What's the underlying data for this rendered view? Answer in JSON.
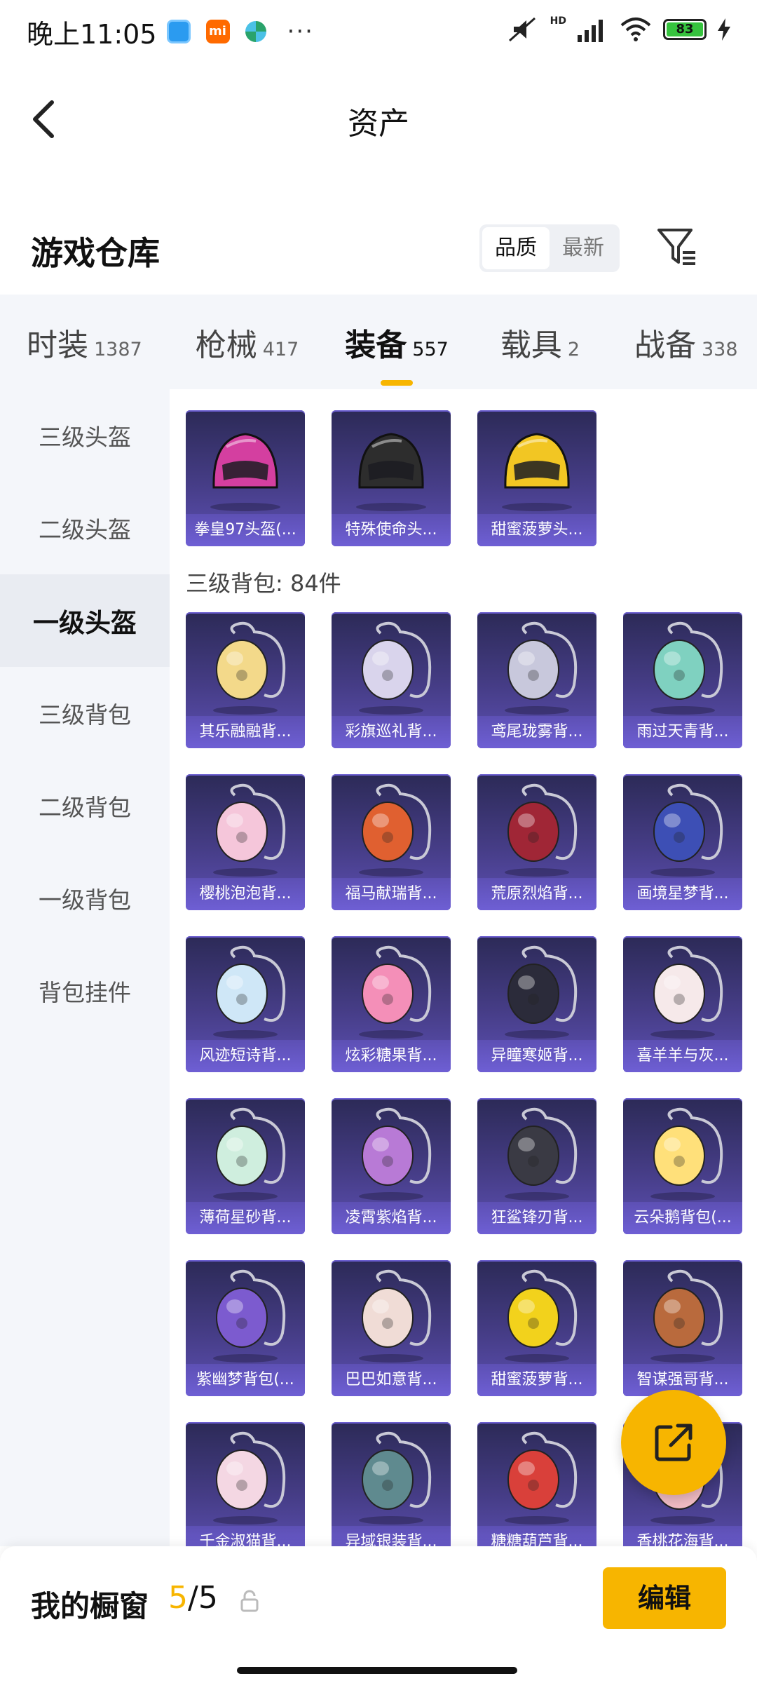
{
  "status_bar": {
    "time": "晚上11:05",
    "more": "···",
    "network": "HD",
    "battery": "83"
  },
  "header": {
    "title": "资产",
    "back_icon": "chevron-left-icon"
  },
  "warehouse": {
    "title": "游戏仓库",
    "sort_options": [
      {
        "label": "品质",
        "active": true
      },
      {
        "label": "最新",
        "active": false
      }
    ],
    "filter_icon": "filter-icon"
  },
  "tabs": [
    {
      "label": "时装",
      "count": "1387",
      "active": false
    },
    {
      "label": "枪械",
      "count": "417",
      "active": false
    },
    {
      "label": "装备",
      "count": "557",
      "active": true
    },
    {
      "label": "载具",
      "count": "2",
      "active": false
    },
    {
      "label": "战备",
      "count": "338",
      "active": false
    }
  ],
  "sidebar": {
    "items": [
      {
        "label": "三级头盔",
        "active": false
      },
      {
        "label": "二级头盔",
        "active": false
      },
      {
        "label": "一级头盔",
        "active": true
      },
      {
        "label": "三级背包",
        "active": false
      },
      {
        "label": "二级背包",
        "active": false
      },
      {
        "label": "一级背包",
        "active": false
      },
      {
        "label": "背包挂件",
        "active": false
      }
    ]
  },
  "content": {
    "helmets": [
      {
        "name": "拳皇97头盔(...",
        "icon": "helmet-icon",
        "color": "#d43fa0"
      },
      {
        "name": "特殊使命头...",
        "icon": "helmet-icon",
        "color": "#2d2d2d"
      },
      {
        "name": "甜蜜菠萝头...",
        "icon": "helmet-icon",
        "color": "#f2c623"
      }
    ],
    "backpack_section_label": "三级背包: 84件",
    "backpacks": [
      {
        "name": "其乐融融背...",
        "icon": "backpack-icon",
        "color": "#f3d98a"
      },
      {
        "name": "彩旗巡礼背...",
        "icon": "backpack-icon",
        "color": "#d9d4ec"
      },
      {
        "name": "鸢尾珑雾背...",
        "icon": "backpack-icon",
        "color": "#c8c8dc"
      },
      {
        "name": "雨过天青背...",
        "icon": "backpack-icon",
        "color": "#7fd1c0"
      },
      {
        "name": "樱桃泡泡背...",
        "icon": "backpack-icon",
        "color": "#f5c6da"
      },
      {
        "name": "福马献瑞背...",
        "icon": "backpack-icon",
        "color": "#e06030"
      },
      {
        "name": "荒原烈焰背...",
        "icon": "backpack-icon",
        "color": "#a02636"
      },
      {
        "name": "画境星梦背...",
        "icon": "backpack-icon",
        "color": "#3d4fb5"
      },
      {
        "name": "风迹短诗背...",
        "icon": "backpack-icon",
        "color": "#cfe7f7"
      },
      {
        "name": "炫彩糖果背...",
        "icon": "backpack-icon",
        "color": "#f48fb8"
      },
      {
        "name": "异瞳寒姬背...",
        "icon": "backpack-icon",
        "color": "#2b2b3a"
      },
      {
        "name": "喜羊羊与灰...",
        "icon": "backpack-icon",
        "color": "#f6e9ea"
      },
      {
        "name": "薄荷星砂背...",
        "icon": "backpack-icon",
        "color": "#cfeede"
      },
      {
        "name": "凌霄紫焰背...",
        "icon": "backpack-icon",
        "color": "#b87ad6"
      },
      {
        "name": "狂鲨锋刃背...",
        "icon": "backpack-icon",
        "color": "#3a3a44"
      },
      {
        "name": "云朵鹅背包(...",
        "icon": "backpack-icon",
        "color": "#ffe07a"
      },
      {
        "name": "紫幽梦背包(...",
        "icon": "backpack-icon",
        "color": "#7c5bcf"
      },
      {
        "name": "巴巴如意背...",
        "icon": "backpack-icon",
        "color": "#f0dcd6"
      },
      {
        "name": "甜蜜菠萝背...",
        "icon": "backpack-icon",
        "color": "#f2d21c"
      },
      {
        "name": "智谋强哥背...",
        "icon": "backpack-icon",
        "color": "#b96a3d"
      },
      {
        "name": "千金淑猫背...",
        "icon": "backpack-icon",
        "color": "#f4d7e3"
      },
      {
        "name": "异域银装背...",
        "icon": "backpack-icon",
        "color": "#5f8a8f"
      },
      {
        "name": "糖糖葫芦背...",
        "icon": "backpack-icon",
        "color": "#d9403a"
      },
      {
        "name": "香桃花海背...",
        "icon": "backpack-icon",
        "color": "#f2bcc4"
      }
    ]
  },
  "fab": {
    "icon": "share-icon"
  },
  "bottom_bar": {
    "label": "我的橱窗",
    "count_used": "5",
    "count_sep_total": "/5",
    "lock_icon": "lock-icon",
    "edit_label": "编辑"
  },
  "colors": {
    "accent": "#f7b500",
    "card_bg_top": "#2c2a57",
    "card_bg_bottom": "#5d50b4",
    "tab_bg": "#f4f6fa"
  }
}
